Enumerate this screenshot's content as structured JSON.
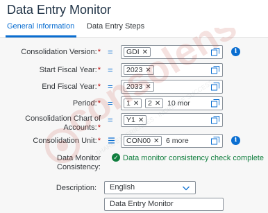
{
  "header": {
    "title": "Data Entry Monitor"
  },
  "tabs": [
    {
      "label": "General Information",
      "active": true
    },
    {
      "label": "Data Entry Steps",
      "active": false
    }
  ],
  "form": {
    "required_mark": "*",
    "consolidation_version": {
      "label": "Consolidation Version:",
      "tokens": [
        "GDI"
      ]
    },
    "start_fiscal_year": {
      "label": "Start Fiscal Year:",
      "tokens": [
        "2023"
      ]
    },
    "end_fiscal_year": {
      "label": "End Fiscal Year:",
      "tokens": [
        "2033"
      ]
    },
    "period": {
      "label": "Period:",
      "tokens": [
        "1",
        "2"
      ],
      "more": "10 mor"
    },
    "chart_of_accounts": {
      "label_line1": "Consolidation Chart of",
      "label_line2": "Accounts:",
      "tokens": [
        "Y1"
      ]
    },
    "consolidation_unit": {
      "label": "Consolidation Unit:",
      "tokens": [
        "CON00"
      ],
      "more": "6 more"
    },
    "data_monitor_consistency": {
      "label_line1": "Data Monitor",
      "label_line2": "Consistency:",
      "status_text": "Data monitor consistency check complete"
    },
    "description": {
      "label": "Description:",
      "selected": "English"
    },
    "description_text": {
      "value": "Data Entry Monitor"
    }
  },
  "watermark": {
    "brand": "consolens",
    "tagline": "SHARE EXPERIENCES · INCREASE SUCCESS"
  },
  "colors": {
    "accent": "#0a6ed1",
    "required": "#bb0000",
    "success": "#107e3e",
    "watermark": "#c0392b"
  },
  "icons": {
    "value_help": "value-help-icon",
    "info": "info-icon",
    "token_delete": "close-icon",
    "status": "check-circle-icon",
    "dropdown": "chevron-down-icon"
  }
}
